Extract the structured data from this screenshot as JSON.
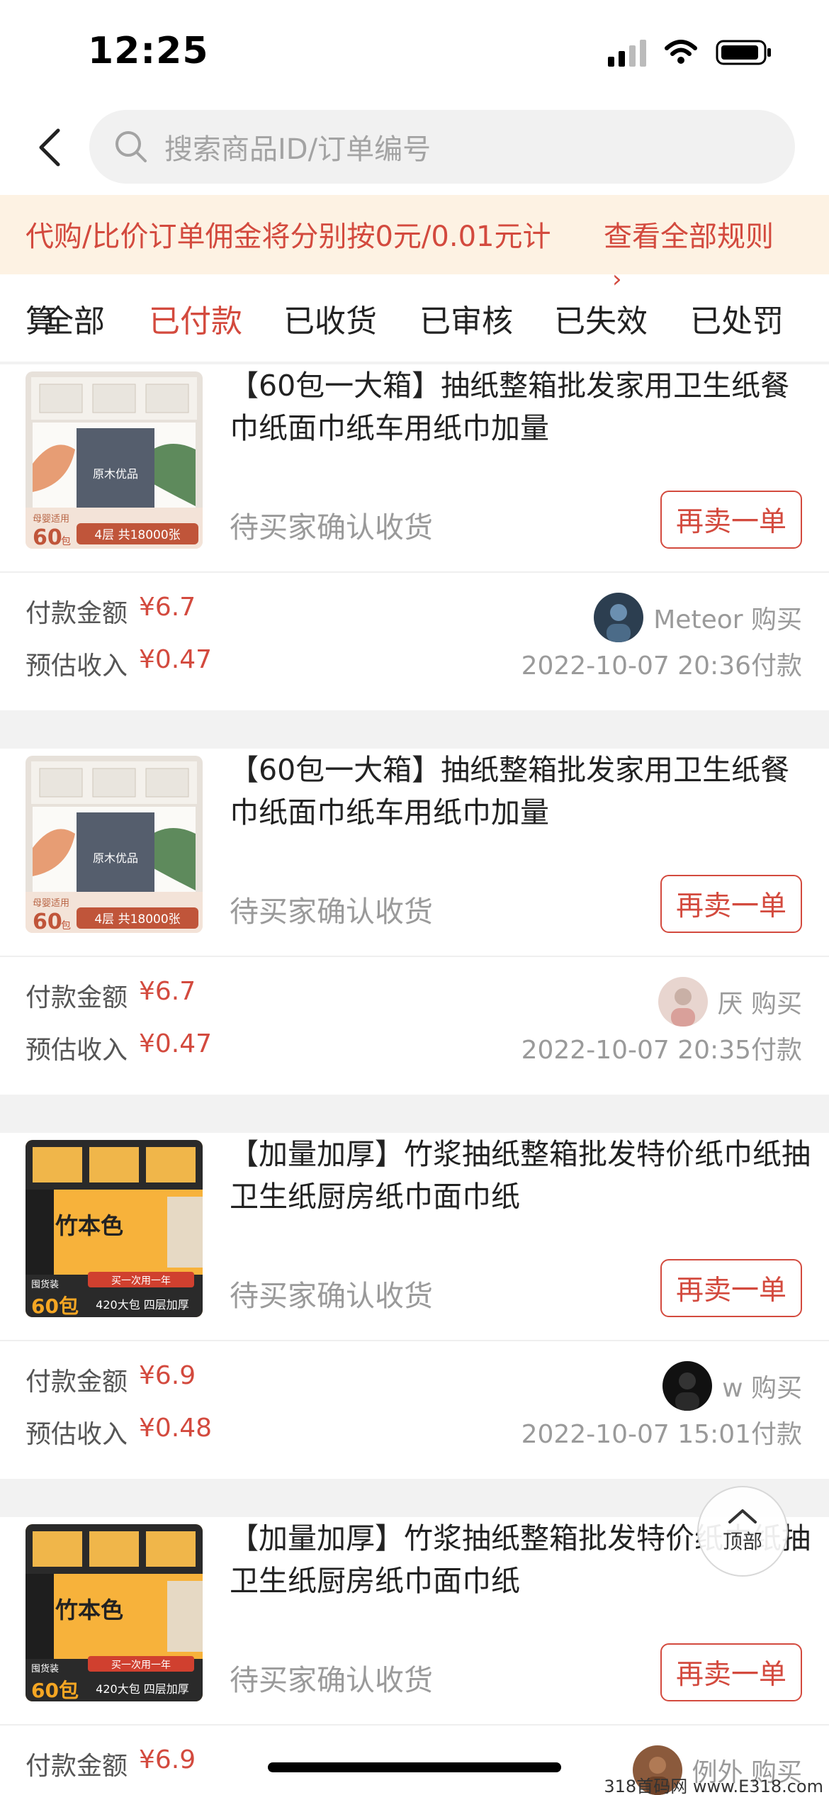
{
  "status_bar": {
    "time": "12:25"
  },
  "search": {
    "placeholder": "搜索商品ID/订单编号"
  },
  "notice": {
    "text": "代购/比价订单佣金将分别按0元/0.01元计",
    "wrap_char": "算",
    "link": "查看全部规则"
  },
  "tabs": [
    {
      "label": "全部",
      "active": false
    },
    {
      "label": "已付款",
      "active": true
    },
    {
      "label": "已收货",
      "active": false
    },
    {
      "label": "已审核",
      "active": false
    },
    {
      "label": "已失效",
      "active": false
    },
    {
      "label": "已处罚",
      "active": false
    }
  ],
  "labels": {
    "pay_amount": "付款金额",
    "est_income": "预估收入",
    "rebuy": "再卖一单"
  },
  "orders": [
    {
      "title": "【60包一大箱】抽纸整箱批发家用卫生纸餐巾纸面巾纸车用纸巾加量",
      "status": "待买家确认收货",
      "pay_amount": "¥6.7",
      "est_income": "¥0.47",
      "buyer": "Meteor 购买",
      "pay_time": "2022-10-07 20:36付款",
      "product_style": "white",
      "thumb_badge": "60",
      "thumb_badge_unit": "包",
      "thumb_caption": "4层 共18000张",
      "thumb_top": "母婴适用",
      "thumb_brand": "原木优品"
    },
    {
      "title": "【60包一大箱】抽纸整箱批发家用卫生纸餐巾纸面巾纸车用纸巾加量",
      "status": "待买家确认收货",
      "pay_amount": "¥6.7",
      "est_income": "¥0.47",
      "buyer": "厌 购买",
      "pay_time": "2022-10-07 20:35付款",
      "product_style": "white",
      "thumb_badge": "60",
      "thumb_badge_unit": "包",
      "thumb_caption": "4层 共18000张",
      "thumb_top": "母婴适用",
      "thumb_brand": "原木优品"
    },
    {
      "title": "【加量加厚】竹浆抽纸整箱批发特价纸巾纸抽卫生纸厨房纸巾面巾纸",
      "status": "待买家确认收货",
      "pay_amount": "¥6.9",
      "est_income": "¥0.48",
      "buyer": "w 购买",
      "pay_time": "2022-10-07 15:01付款",
      "product_style": "bamboo",
      "thumb_badge": "60包",
      "thumb_badge_unit": "",
      "thumb_caption": "420大包 四层加厚",
      "thumb_top": "囤货装",
      "thumb_brand": "竹本色",
      "thumb_sub": "买一次用一年"
    },
    {
      "title": "【加量加厚】竹浆抽纸整箱批发特价纸巾纸抽卫生纸厨房纸巾面巾纸",
      "status": "待买家确认收货",
      "pay_amount": "¥6.9",
      "est_income": "",
      "buyer": "例外 购买",
      "pay_time": "",
      "product_style": "bamboo",
      "thumb_badge": "60包",
      "thumb_badge_unit": "",
      "thumb_caption": "420大包 四层加厚",
      "thumb_top": "囤货装",
      "thumb_brand": "竹本色",
      "thumb_sub": "买一次用一年"
    }
  ],
  "to_top": {
    "label": "顶部"
  },
  "watermark": "318首码网 www.E318.com",
  "colors": {
    "accent": "#d34a3e",
    "notice_bg": "#fdf2e3",
    "muted": "#9a9a9a"
  }
}
